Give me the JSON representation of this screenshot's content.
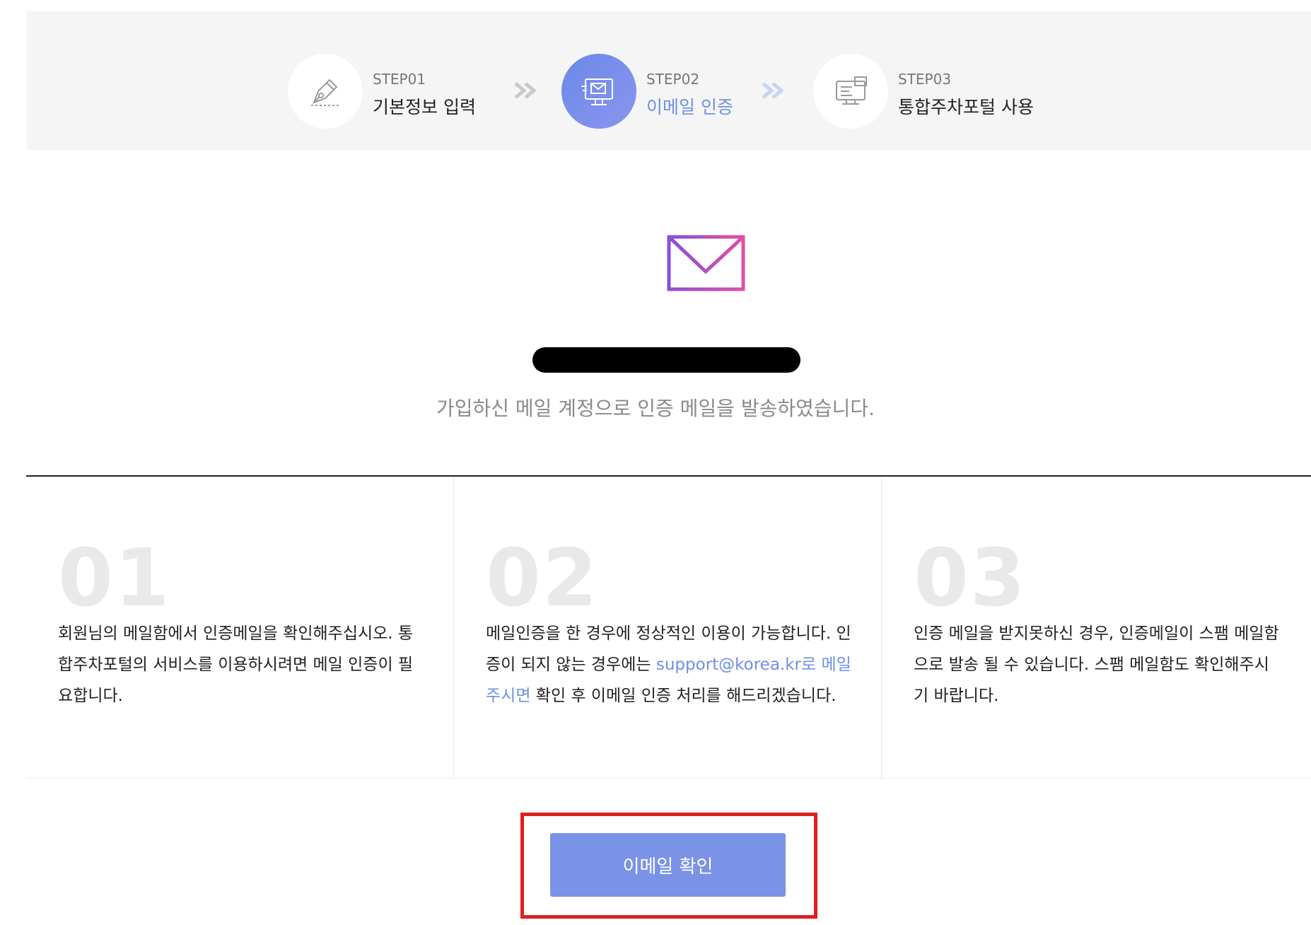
{
  "steps": [
    {
      "sub": "STEP01",
      "title": "기본정보 입력",
      "icon": "pen-nib-icon"
    },
    {
      "sub": "STEP02",
      "title": "이메일 인증",
      "icon": "monitor-mail-icon",
      "active": true
    },
    {
      "sub": "STEP03",
      "title": "통합주차포털 사용",
      "icon": "computer-icon"
    }
  ],
  "hero": {
    "icon": "envelope-send-icon",
    "message": "가입하신 메일 계정으로 인증 메일을 발송하였습니다."
  },
  "info": [
    {
      "num": "01",
      "text": "회원님의 메일함에서 인증메일을 확인해주십시오. 통합주차포털의 서비스를 이용하시려면 메일 인증이 필요합니다."
    },
    {
      "num": "02",
      "text_before": "메일인증을 한 경우에 정상적인 이용이 가능합니다. 인증이 되지 않는 경우에는 ",
      "link": "support@korea.kr로 메일 주시면",
      "text_after": " 확인 후 이메일 인증 처리를 해드리겠습니다."
    },
    {
      "num": "03",
      "text": "인증 메일을 받지못하신 경우, 인증메일이 스팸 메일함으로 발송 될 수 있습니다. 스팸 메일함도 확인해주시기 바랍니다."
    }
  ],
  "confirm_button": "이메일 확인",
  "colors": {
    "accent": "#6e8fe6",
    "button": "#7a93e6",
    "highlight": "#e02020",
    "envelope_start": "#8a4fd6",
    "envelope_end": "#e04fa8"
  }
}
